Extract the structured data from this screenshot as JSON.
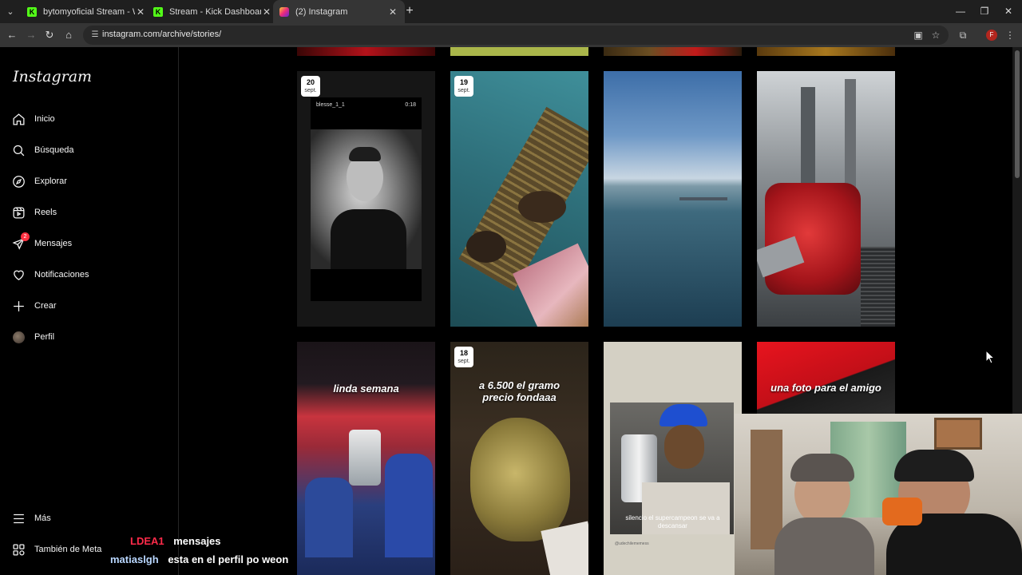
{
  "browser": {
    "tabs": [
      {
        "label": "bytomyoficial Stream - Watch L",
        "favicon": "K",
        "active": false
      },
      {
        "label": "Stream - Kick Dashboard",
        "favicon": "K",
        "active": false
      },
      {
        "label": "(2) Instagram",
        "favicon": "instagram-icon",
        "active": true
      }
    ],
    "url": "instagram.com/archive/stories/",
    "profile_initial": "F"
  },
  "sidebar": {
    "logo": "Instagram",
    "items": [
      {
        "label": "Inicio",
        "icon": "home-icon"
      },
      {
        "label": "Búsqueda",
        "icon": "search-icon"
      },
      {
        "label": "Explorar",
        "icon": "compass-icon"
      },
      {
        "label": "Reels",
        "icon": "reels-icon"
      },
      {
        "label": "Mensajes",
        "icon": "messenger-icon",
        "badge": "2"
      },
      {
        "label": "Notificaciones",
        "icon": "heart-icon"
      },
      {
        "label": "Crear",
        "icon": "plus-icon"
      },
      {
        "label": "Perfil",
        "icon": "avatar"
      }
    ],
    "more": "Más",
    "also_from_meta": "También de Meta"
  },
  "stories": {
    "row1": [
      {
        "day": "20",
        "month": "sept.",
        "username": "blesse_1_1",
        "duration": "0:18"
      },
      {
        "day": "19",
        "month": "sept."
      },
      {},
      {}
    ],
    "row2": [
      {
        "caption": "linda semana"
      },
      {
        "day": "18",
        "month": "sept.",
        "caption": "a 6.500 el gramo precio fondaaa"
      },
      {
        "caption": "silencio el supercampeon se va a descansar",
        "handle": "@udechilememess"
      },
      {
        "caption": "una foto para el amigo"
      }
    ]
  },
  "chat": [
    {
      "user": "LDEA1",
      "user_color": "#ff2b4a",
      "message": "mensajes"
    },
    {
      "user": "matiaslgh",
      "user_color": "#b9d7ff",
      "message": "esta en el perfil po weon"
    }
  ],
  "colors": {
    "ig_bg": "#000000",
    "badge": "#ff3040",
    "kick": "#53fc18"
  }
}
